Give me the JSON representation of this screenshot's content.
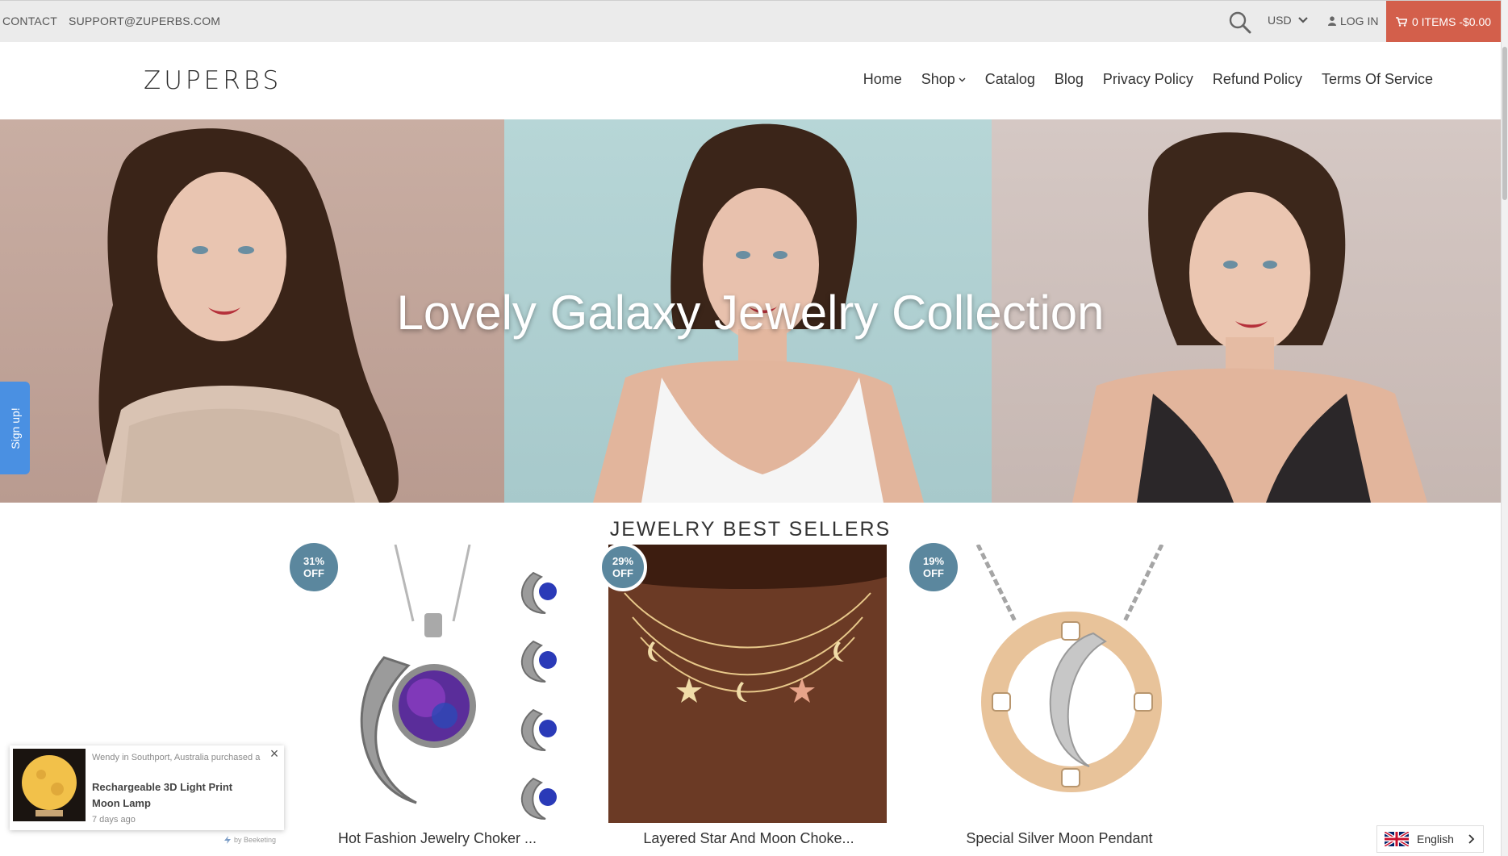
{
  "topbar": {
    "contact_label": "CONTACT",
    "email": "SUPPORT@ZUPERBS.COM",
    "currency": "USD",
    "login_label": "LOG IN",
    "cart_label": "0 ITEMS -$0.00"
  },
  "header": {
    "logo": "ZUPERBS",
    "nav": [
      "Home",
      "Shop",
      "Catalog",
      "Blog",
      "Privacy Policy",
      "Refund Policy",
      "Terms Of Service"
    ]
  },
  "hero": {
    "title": "Lovely Galaxy Jewelry Collection"
  },
  "signup_tab": "Sign up!",
  "best_sellers": {
    "title": "JEWELRY BEST SELLERS",
    "products": [
      {
        "title": "Hot Fashion Jewelry Choker ...",
        "badge_pct": "31%",
        "badge_off": "OFF"
      },
      {
        "title": "Layered Star And Moon Choke...",
        "badge_pct": "29%",
        "badge_off": "OFF"
      },
      {
        "title": "Special Silver Moon Pendant",
        "badge_pct": "19%",
        "badge_off": "OFF"
      }
    ]
  },
  "notification": {
    "who": "Wendy in Southport, Australia purchased a",
    "product": "Rechargeable 3D Light Print Moon Lamp",
    "ago": "7 days ago",
    "byline": "by Beeketing"
  },
  "language": {
    "selected": "English"
  },
  "colors": {
    "cart_bg": "#d35f4b",
    "badge_bg": "#5b879e",
    "signup_bg": "#4a90e2",
    "topbar_bg": "#ebebeb"
  }
}
